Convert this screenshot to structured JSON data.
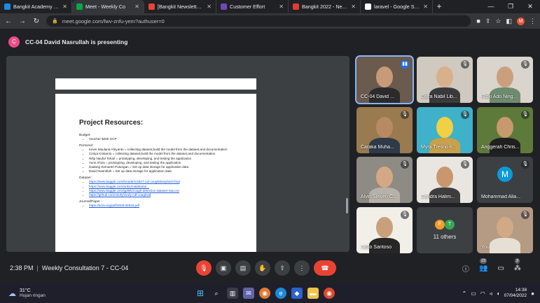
{
  "browser": {
    "tabs": [
      {
        "title": "Bangkit Academy - Ca",
        "icon": "bangkit-favicon",
        "color": "#1e88e5",
        "active": false
      },
      {
        "title": "Meet - Weekly Co",
        "icon": "meet-favicon",
        "color": "#00ac47",
        "active": true
      },
      {
        "title": "[Bangkit Newsletter #",
        "icon": "gmail-favicon",
        "color": "#ea4335",
        "active": false
      },
      {
        "title": "Customer Effort",
        "icon": "forms-favicon",
        "color": "#7248b9",
        "active": false
      },
      {
        "title": "Bangkit 2022 - Newsl",
        "icon": "bangkit-favicon",
        "color": "#e53935",
        "active": false
      },
      {
        "title": "laravel - Google Sear",
        "icon": "google-favicon",
        "color": "#ffffff",
        "active": false
      }
    ],
    "new_tab": "+",
    "url": "meet.google.com/fwv-znfu-yem?authuser=0",
    "profile_initial": "M"
  },
  "meeting": {
    "presenter_initial": "C",
    "presenting_text": "CC-04 David Nasrullah is presenting",
    "time": "2:38 PM",
    "title": "Weekly Consultation 7 - CC-04",
    "participant_count": "23",
    "reactions_count": "3"
  },
  "document": {
    "heading": "Project Resources:",
    "sections": [
      {
        "label": "Budget:",
        "items": [
          "Voucher $200 GCP"
        ],
        "link": false
      },
      {
        "label": "Personel:",
        "items": [
          "Kevin Maulana Afriyanto = collecting dataset,build the model from the dataset,and documentation",
          "Cintya Kristanto = collecting dataset,build the model from the dataset,and documentation",
          "Rifqi Naufal Tohari = prototyping, developing, and testing the application",
          "Yumi Ahiza = prototyping, developing, and testing the application",
          "Dadang Sumantri Putungan = Set up data storage for application data",
          "David Nasrullah = Set up data storage for application data"
        ],
        "link": false
      },
      {
        "label": "Dataset :",
        "items": [
          "https://www.kaggle.com/kmader/cs827-12l-coughsleep/test-final",
          "https://www.kaggle.com/ankurmalakaria/...",
          "https://www.kaggle.com/gpliek/cough-detection-dataset-raw.csv",
          "https://github.com/virufy/virufy-cdf-coughvid"
        ],
        "link": true
      },
      {
        "label": "Journal/Paper :",
        "items": [
          "https://arxiv.org/pdf/2006.05919.pdf"
        ],
        "link": true
      }
    ]
  },
  "participants": [
    {
      "name": "CC-04 David ...",
      "mic": "speaking",
      "bg": "#6b5a4e",
      "skin": "#c99a78",
      "shirt": "#2b2b2b"
    },
    {
      "name": "Daffa Nabil Lib...",
      "mic": "muted",
      "bg": "#cfc9bf",
      "skin": "#d8b08c",
      "shirt": "#3a3a3a"
    },
    {
      "name": "Rizki Ado Ning...",
      "mic": "muted",
      "bg": "#d9d4cc",
      "skin": "#caa07c",
      "shirt": "#6e8b6f"
    },
    {
      "name": "Caraka Muha...",
      "mic": "muted",
      "bg": "#9a7a4f",
      "skin": "#b88a63",
      "shirt": "#2e3a4a"
    },
    {
      "name": "Myra Tresno K...",
      "mic": "muted",
      "bg": "#3fb1c9",
      "skin": "#f1d046",
      "shirt": "#c9a14a"
    },
    {
      "name": "Anggerah Chris...",
      "mic": "muted",
      "bg": "#5d7a3a",
      "skin": "#c7996f",
      "shirt": "#1f1f1f"
    },
    {
      "name": "Alvin Steven C...",
      "mic": "muted",
      "bg": "#8e8b84",
      "skin": "#d4a884",
      "shirt": "#b7b2a8"
    },
    {
      "name": "Candra Halim...",
      "mic": "muted",
      "bg": "#e9e6e1",
      "skin": "#c9976f",
      "shirt": "#3d3d3d"
    },
    {
      "name": "Mohammad Alla...",
      "mic": "muted",
      "avatar": "M",
      "avatar_color": "#0b9bd8"
    },
    {
      "name": "Ramadhan Cipto Santoso",
      "display": "Cipto Santoso",
      "mic": "muted",
      "bg": "#f2efe9",
      "skin": "#caa07c",
      "shirt": "#262626"
    },
    {
      "name": "11 others",
      "others": [
        "F",
        "T"
      ],
      "others_colors": [
        "#f39c2b",
        "#34a853"
      ]
    },
    {
      "name": "You",
      "mic": "muted",
      "bg": "#b59b83",
      "skin": "#d1a987",
      "shirt": "#e6e0d4"
    }
  ],
  "taskbar": {
    "temp": "31°C",
    "weather": "Hujan ringan",
    "time": "14:38",
    "date": "07/04/2022"
  }
}
